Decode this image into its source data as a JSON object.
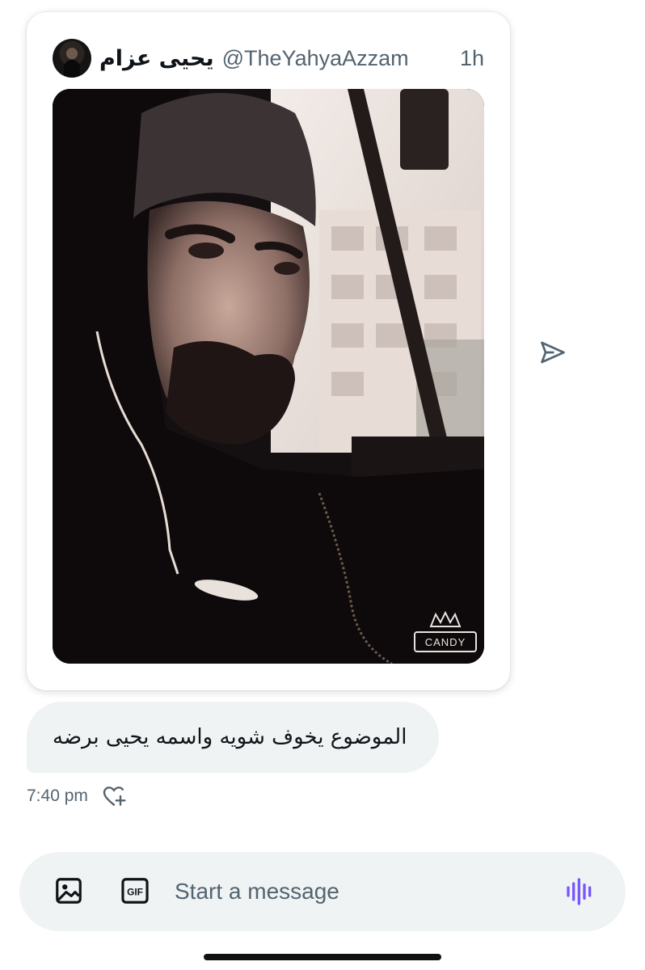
{
  "tweet": {
    "display_name": "يحيى عزام",
    "handle": "@TheYahyaAzzam",
    "time_ago": "1h",
    "media_watermark": "CANDY"
  },
  "message": {
    "text": "الموضوع يخوف شويه واسمه يحيى برضه",
    "time": "7:40 pm"
  },
  "composer": {
    "placeholder": "Start a message",
    "gif_label": "GIF"
  },
  "icons": {
    "share": "share-arrow-icon",
    "react": "heart-plus-icon",
    "media": "image-icon",
    "gif": "gif-icon",
    "voice": "voice-waveform-icon"
  },
  "colors": {
    "secondary_text": "#536471",
    "bubble_bg": "#eff3f4",
    "voice_accent": "#7856ff",
    "icon_gray": "#536471"
  }
}
